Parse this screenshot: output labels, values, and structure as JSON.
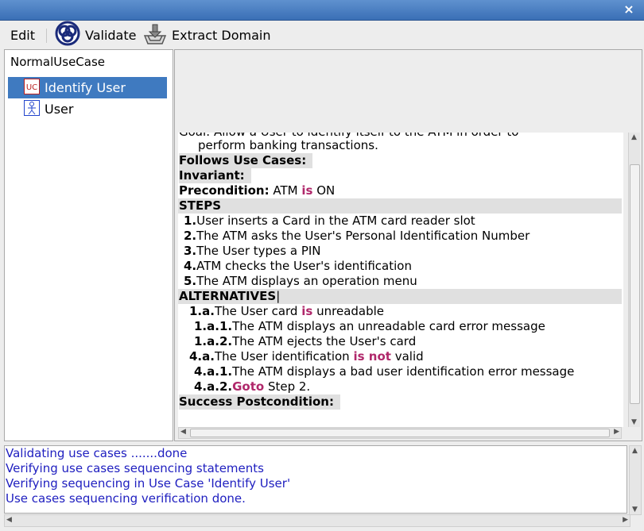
{
  "window": {
    "close_glyph": "×"
  },
  "toolbar": {
    "edit_label": "Edit",
    "validate_label": "Validate",
    "extract_label": "Extract Domain"
  },
  "tree": {
    "root_label": "NormalUseCase",
    "items": [
      {
        "label": "Identify User",
        "icon": "use-case-icon",
        "selected": true
      },
      {
        "label": "User",
        "icon": "actor-icon",
        "selected": false
      }
    ]
  },
  "editor": {
    "goal_cut": "Goal:  Allow a User to identify itself to the ATM in order to",
    "goal_cont": "perform banking transactions.",
    "follows": "Follows Use Cases:",
    "invariant": "Invariant:",
    "precondition_label": "Precondition:",
    "precondition_a": "ATM",
    "precondition_kw": "is",
    "precondition_b": "ON",
    "steps_heading": "STEPS",
    "steps": [
      {
        "num": "1.",
        "text": "User inserts a Card in the ATM card reader slot"
      },
      {
        "num": "2.",
        "text": "The ATM asks the User's Personal Identification Number"
      },
      {
        "num": "3.",
        "text": "The User types a PIN"
      },
      {
        "num": "4.",
        "text": "ATM checks the User's identification"
      },
      {
        "num": "5.",
        "text": "The ATM displays an operation menu"
      }
    ],
    "alternatives_heading": "ALTERNATIVES",
    "alt1_num": "1.a.",
    "alt1_text_a": "The User card",
    "alt1_kw": "is",
    "alt1_text_b": "unreadable",
    "alt1a1_num": "1.a.1.",
    "alt1a1_text": "The ATM displays an unreadable card error message",
    "alt1a2_num": "1.a.2.",
    "alt1a2_text": "The ATM ejects the User's card",
    "alt4_num": "4.a.",
    "alt4_text_a": "The User identification",
    "alt4_kw": "is not",
    "alt4_text_b": "valid",
    "alt4a1_num": "4.a.1.",
    "alt4a1_text": "The ATM displays a bad user identification error message",
    "alt4a2_num": "4.a.2.",
    "alt4a2_kw": "Goto",
    "alt4a2_text": "Step  2.",
    "postcondition": "Success Postcondition:"
  },
  "console": {
    "lines": [
      "Validating use cases .......done",
      "Verifying use cases sequencing statements",
      " Verifying sequencing in Use Case 'Identify User'",
      "Use cases sequencing verification done."
    ]
  },
  "colors": {
    "keyword": "#b0286b",
    "console_text": "#2020c0",
    "selection": "#3f7ac0"
  }
}
